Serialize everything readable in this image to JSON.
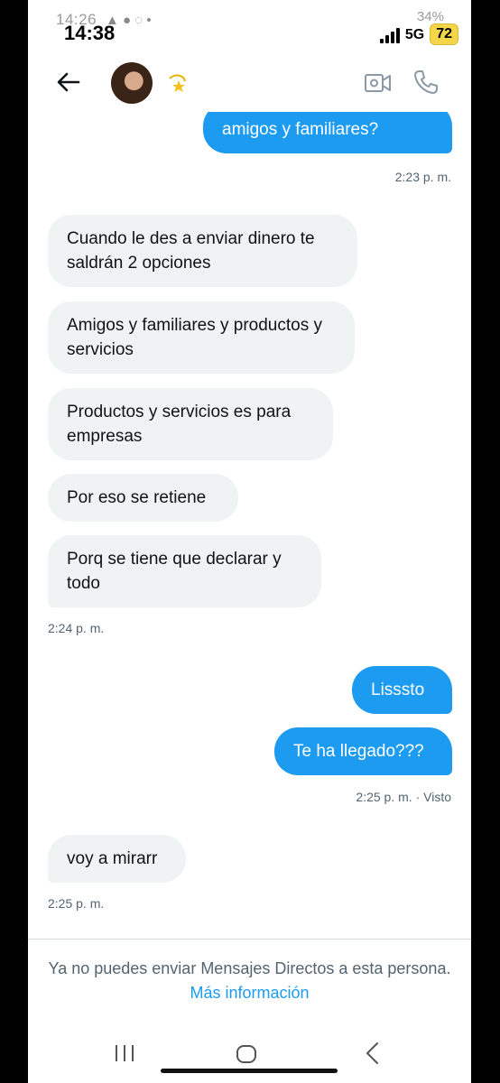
{
  "status_bar": {
    "time_behind": "14:26",
    "time": "14:38",
    "battery_behind": "34%",
    "network": "5G",
    "battery_badge": "72"
  },
  "header": {
    "icons": [
      "back-arrow-icon",
      "avatar",
      "dizzy-star-emoji",
      "video-call-icon",
      "phone-call-icon"
    ]
  },
  "messages": [
    {
      "from": "me",
      "text": "amigos y familiares?"
    },
    {
      "type": "timestamp",
      "text": "2:23 p. m."
    },
    {
      "from": "them",
      "text": "Cuando le des a enviar dinero te saldrán 2 opciones"
    },
    {
      "from": "them",
      "text": "Amigos y familiares y productos y servicios"
    },
    {
      "from": "them",
      "text": "Productos y servicios es para empresas"
    },
    {
      "from": "them",
      "text": "Por eso se retiene"
    },
    {
      "from": "them",
      "text": "Porq se tiene que declarar y todo"
    },
    {
      "type": "timestamp",
      "text": "2:24 p. m."
    },
    {
      "from": "me",
      "text": "Lisssto"
    },
    {
      "from": "me",
      "text": "Te ha llegado???"
    },
    {
      "type": "timestamp",
      "text": "2:25 p. m. · Visto"
    },
    {
      "from": "them",
      "text": "voy a mirarr"
    },
    {
      "type": "timestamp",
      "text": "2:25 p. m."
    }
  ],
  "notice": {
    "text": "Ya no puedes enviar Mensajes Directos a esta persona.",
    "link": "Más información"
  },
  "colors": {
    "outgoing_bubble": "#1d9bf0",
    "incoming_bubble": "#eff3f4",
    "link": "#1d9bf0",
    "badge": "#f3d648"
  }
}
